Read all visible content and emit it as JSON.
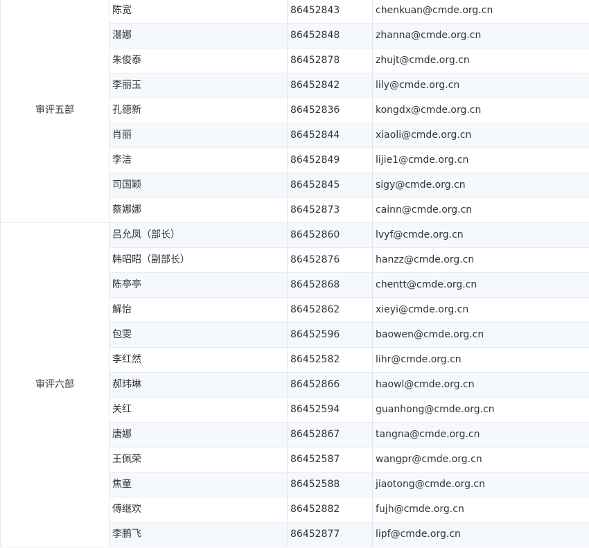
{
  "departments": [
    {
      "name": "审评五部",
      "members": [
        {
          "name": "陈宽",
          "phone": "86452843",
          "email": "chenkuan@cmde.org.cn"
        },
        {
          "name": "湛娜",
          "phone": "86452848",
          "email": "zhanna@cmde.org.cn"
        },
        {
          "name": "朱俊泰",
          "phone": "86452878",
          "email": "zhujt@cmde.org.cn"
        },
        {
          "name": "李丽玉",
          "phone": "86452842",
          "email": "lily@cmde.org.cn"
        },
        {
          "name": "孔德新",
          "phone": "86452836",
          "email": "kongdx@cmde.org.cn"
        },
        {
          "name": "肖丽",
          "phone": "86452844",
          "email": "xiaoli@cmde.org.cn"
        },
        {
          "name": "李洁",
          "phone": "86452849",
          "email": "lijie1@cmde.org.cn"
        },
        {
          "name": "司国颖",
          "phone": "86452845",
          "email": "sigy@cmde.org.cn"
        },
        {
          "name": "蔡娜娜",
          "phone": "86452873",
          "email": "cainn@cmde.org.cn"
        }
      ]
    },
    {
      "name": "审评六部",
      "members": [
        {
          "name": "吕允凤（部长）",
          "phone": "86452860",
          "email": "lvyf@cmde.org.cn"
        },
        {
          "name": "韩昭昭（副部长）",
          "phone": "86452876",
          "email": "hanzz@cmde.org.cn"
        },
        {
          "name": "陈亭亭",
          "phone": "86452868",
          "email": "chentt@cmde.org.cn"
        },
        {
          "name": "解怡",
          "phone": "86452862",
          "email": "xieyi@cmde.org.cn"
        },
        {
          "name": "包雯",
          "phone": "86452596",
          "email": "baowen@cmde.org.cn"
        },
        {
          "name": "李红然",
          "phone": "86452582",
          "email": "lihr@cmde.org.cn"
        },
        {
          "name": "郝玮琳",
          "phone": "86452866",
          "email": "haowl@cmde.org.cn"
        },
        {
          "name": "关红",
          "phone": "86452594",
          "email": "guanhong@cmde.org.cn"
        },
        {
          "name": "唐娜",
          "phone": "86452867",
          "email": "tangna@cmde.org.cn"
        },
        {
          "name": "王佩荣",
          "phone": "86452587",
          "email": "wangpr@cmde.org.cn"
        },
        {
          "name": "焦童",
          "phone": "86452588",
          "email": "jiaotong@cmde.org.cn"
        },
        {
          "name": "傅继欢",
          "phone": "86452882",
          "email": "fujh@cmde.org.cn"
        },
        {
          "name": "李鹏飞",
          "phone": "86452877",
          "email": "lipf@cmde.org.cn"
        }
      ]
    }
  ]
}
